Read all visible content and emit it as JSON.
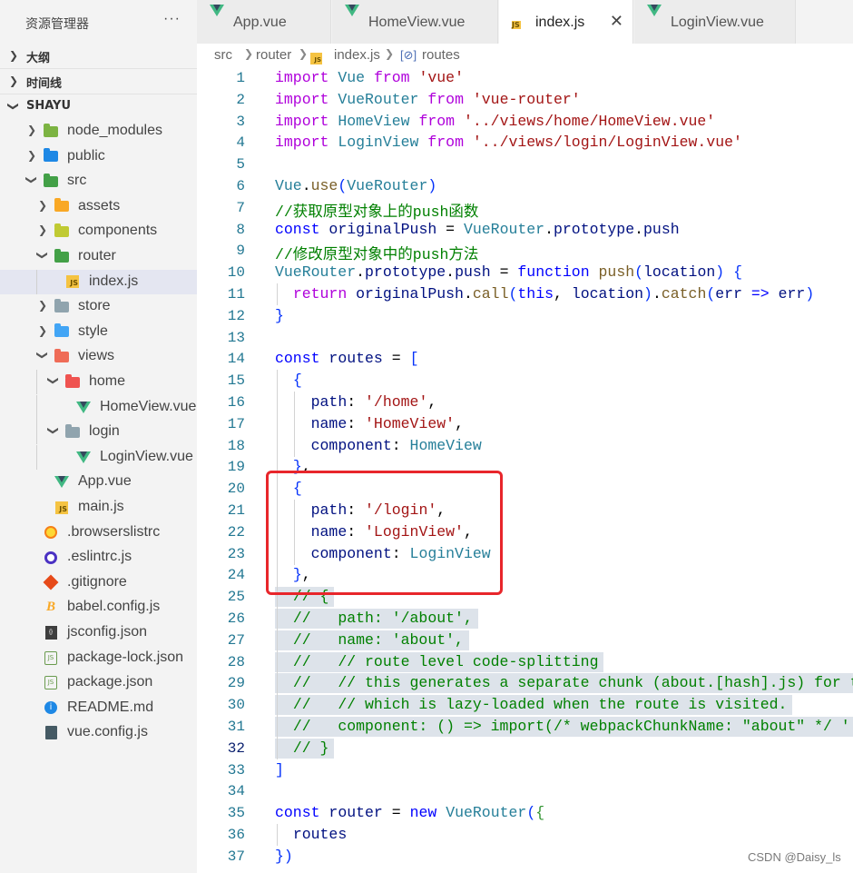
{
  "sidebar": {
    "title": "资源管理器",
    "more": "···",
    "sections": {
      "outline": "大纲",
      "timeline": "时间线",
      "project": "SHAYU"
    },
    "tree": [
      {
        "label": "node_modules",
        "kind": "folder",
        "color": "#7cb342"
      },
      {
        "label": "public",
        "kind": "folder",
        "color": "#1e88e5"
      },
      {
        "label": "src",
        "kind": "folder",
        "color": "#43a047"
      },
      {
        "label": "assets",
        "kind": "folder",
        "color": "#f9a825"
      },
      {
        "label": "components",
        "kind": "folder",
        "color": "#c0ca33"
      },
      {
        "label": "router",
        "kind": "folder",
        "color": "#43a047"
      },
      {
        "label": "index.js",
        "kind": "js"
      },
      {
        "label": "store",
        "kind": "folder",
        "color": "#90a4ae"
      },
      {
        "label": "style",
        "kind": "folder",
        "color": "#42a5f5"
      },
      {
        "label": "views",
        "kind": "folder",
        "color": "#ef6c57"
      },
      {
        "label": "home",
        "kind": "folder",
        "color": "#ef5350"
      },
      {
        "label": "HomeView.vue",
        "kind": "vue"
      },
      {
        "label": "login",
        "kind": "folder",
        "color": "#90a4ae"
      },
      {
        "label": "LoginView.vue",
        "kind": "vue"
      },
      {
        "label": "App.vue",
        "kind": "vue"
      },
      {
        "label": "main.js",
        "kind": "js"
      },
      {
        "label": ".browserslistrc",
        "kind": "browserslist"
      },
      {
        "label": ".eslintrc.js",
        "kind": "eslint"
      },
      {
        "label": ".gitignore",
        "kind": "git"
      },
      {
        "label": "babel.config.js",
        "kind": "babel"
      },
      {
        "label": "jsconfig.json",
        "kind": "jsconfig"
      },
      {
        "label": "package-lock.json",
        "kind": "json"
      },
      {
        "label": "package.json",
        "kind": "json"
      },
      {
        "label": "README.md",
        "kind": "info"
      },
      {
        "label": "vue.config.js",
        "kind": "config"
      }
    ]
  },
  "tabs": [
    {
      "label": "App.vue",
      "kind": "vue"
    },
    {
      "label": "HomeView.vue",
      "kind": "vue"
    },
    {
      "label": "index.js",
      "kind": "js",
      "active": true,
      "close": "✕"
    },
    {
      "label": "LoginView.vue",
      "kind": "vue"
    }
  ],
  "breadcrumb": [
    "src",
    "router",
    "index.js",
    "routes"
  ],
  "editor": {
    "current_line": 32,
    "line_numbers": [
      "1",
      "2",
      "3",
      "4",
      "5",
      "6",
      "7",
      "8",
      "9",
      "10",
      "11",
      "12",
      "13",
      "14",
      "15",
      "16",
      "17",
      "18",
      "19",
      "20",
      "21",
      "22",
      "23",
      "24",
      "25",
      "26",
      "27",
      "28",
      "29",
      "30",
      "31",
      "32",
      "33",
      "34",
      "35",
      "36",
      "37"
    ],
    "lines": [
      "import Vue from 'vue'",
      "import VueRouter from 'vue-router'",
      "import HomeView from '../views/home/HomeView.vue'",
      "import LoginView from '../views/login/LoginView.vue'",
      "",
      "Vue.use(VueRouter)",
      "//获取原型对象上的push函数",
      "const originalPush = VueRouter.prototype.push",
      "//修改原型对象中的push方法",
      "VueRouter.prototype.push = function push(location) {",
      "  return originalPush.call(this, location).catch(err => err)",
      "}",
      "",
      "const routes = [",
      "  {",
      "    path: '/home',",
      "    name: 'HomeView',",
      "    component: HomeView",
      "  },",
      "  {",
      "    path: '/login',",
      "    name: 'LoginView',",
      "    component: LoginView",
      "  },",
      "  // {",
      "  //   path: '/about',",
      "  //   name: 'about',",
      "  //   // route level code-splitting",
      "  //   // this generates a separate chunk (about.[hash].js) for thi",
      "  //   // which is lazy-loaded when the route is visited.",
      "  //   component: () => import(/* webpackChunkName: \"about\" */ '../",
      "  // }",
      "]",
      "",
      "const router = new VueRouter({",
      "  routes",
      "})"
    ]
  },
  "watermark": "CSDN @Daisy_ls",
  "colors": {
    "highlight_box": "#e8262b",
    "selected_row": "#e4e6f1",
    "line_number": "#237893"
  }
}
